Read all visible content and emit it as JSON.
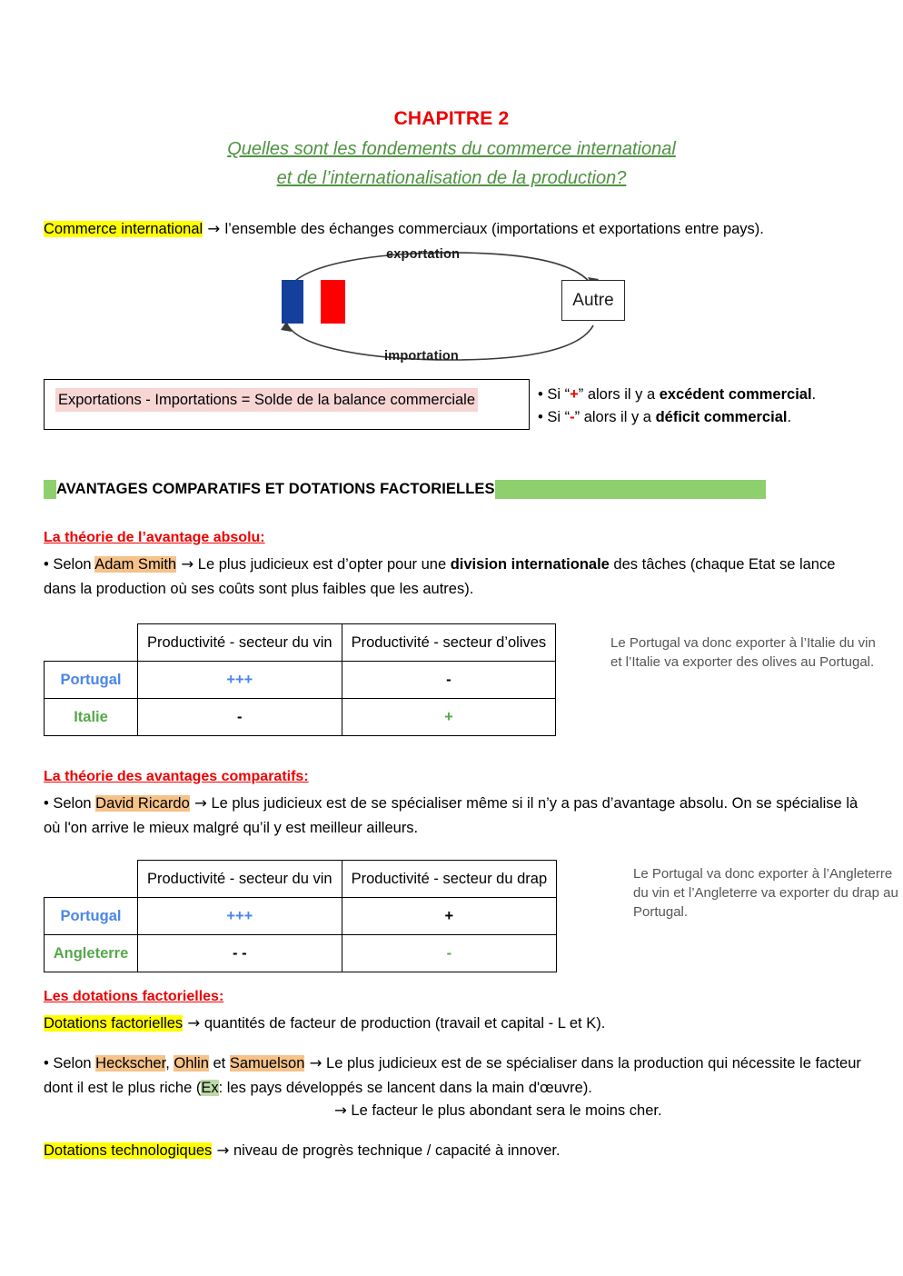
{
  "document": {
    "chapter_title": "CHAPITRE 2",
    "subtitle_line1": "Quelles sont les fondements du commerce international",
    "subtitle_line2": "et de l’internationalisation de la production?"
  },
  "intro": {
    "term": "Commerce international",
    "arrow": "→",
    "definition": "l’ensemble des échanges commerciaux (importations et exportations entre pays)."
  },
  "diagram": {
    "label_export": "exportation",
    "label_import": "importation",
    "partner_box": "Autre",
    "flag_blue_color": "#12409b",
    "flag_red_color": "#fe0000"
  },
  "balance": {
    "formula": "Exportations - Importations = Solde de la balance commerciale",
    "bullet1_prefix": "• Si “",
    "bullet1_sign": "+",
    "bullet1_mid": "” alors il y a ",
    "bullet1_bold": "excédent commercial",
    "bullet1_suffix": ".",
    "bullet2_prefix": "• Si “",
    "bullet2_sign": "-",
    "bullet2_mid": "” alors il y a ",
    "bullet2_bold": "déficit commercial",
    "bullet2_suffix": "."
  },
  "section": {
    "title": "AVANTAGES COMPARATIFS ET DOTATIONS FACTORIELLES",
    "highlight_color": "#8fd06e"
  },
  "absolute_advantage": {
    "heading": "La théorie de l’avantage absolu:",
    "bullet_prefix": "• Selon ",
    "author": "Adam Smith",
    "arrow": "→",
    "text_part1": " Le plus judicieux est d’opter pour une ",
    "bold_term": "division internationale",
    "text_part2": " des tâches (chaque Etat se lance dans la production  où ses coûts sont plus faibles que les autres)."
  },
  "table1": {
    "columns": [
      "",
      "Productivité - secteur du vin",
      "Productivité - secteur d’olives"
    ],
    "rows": [
      {
        "label": "Portugal",
        "label_color": "#4a86e8",
        "cells": [
          {
            "value": "+++",
            "color": "#4a86e8"
          },
          {
            "value": "-",
            "color": "#000000"
          }
        ]
      },
      {
        "label": "Italie",
        "label_color": "#56a84b",
        "cells": [
          {
            "value": "-",
            "color": "#000000"
          },
          {
            "value": "+",
            "color": "#56a84b"
          }
        ]
      }
    ],
    "note": "Le Portugal va donc exporter à l’Italie du vin et l’Italie va exporter des olives au Portugal."
  },
  "comparative_advantage": {
    "heading": "La théorie des avantages comparatifs:",
    "bullet_prefix": "• Selon ",
    "author": "David Ricardo",
    "arrow": "→",
    "text": " Le plus judicieux est de se spécialiser même si il n’y a pas d’avantage absolu. On se spécialise là où l'on arrive le mieux malgré qu’il y est meilleur ailleurs."
  },
  "table2": {
    "columns": [
      "",
      "Productivité - secteur du vin",
      "Productivité - secteur du drap"
    ],
    "rows": [
      {
        "label": "Portugal",
        "label_color": "#4a86e8",
        "cells": [
          {
            "value": "+++",
            "color": "#4a86e8"
          },
          {
            "value": "+",
            "color": "#000000"
          }
        ]
      },
      {
        "label": "Angleterre",
        "label_color": "#56a84b",
        "cells": [
          {
            "value": "-   -",
            "color": "#000000"
          },
          {
            "value": "-",
            "color": "#56a84b"
          }
        ]
      }
    ],
    "note": "Le Portugal va donc exporter à l’Angleterre du vin et l’Angleterre va exporter du drap au Portugal."
  },
  "factor_endowments": {
    "heading": "Les dotations factorielles:",
    "term": "Dotations factorielles",
    "arrow": "→",
    "definition": " quantités de facteur de production (travail et capital -  L et K).",
    "bullet_prefix": "• Selon ",
    "author1": "Heckscher",
    "sep1": ", ",
    "author2": "Ohlin",
    "sep2": " et ",
    "author3": "Samuelson",
    "bullet_arrow": "→",
    "bullet_text1": " Le plus judicieux est de se spécialiser dans la production qui nécessite le facteur dont il est le plus riche (",
    "example_tag": "Ex",
    "bullet_text2": ": les pays développés se lancent dans la main d'œuvre).",
    "conclusion_arrow": "→",
    "conclusion": " Le facteur le plus abondant sera le moins cher.",
    "tech_term": "Dotations technologiques",
    "tech_arrow": "→",
    "tech_definition": " niveau de progrès technique / capacité à innover."
  }
}
